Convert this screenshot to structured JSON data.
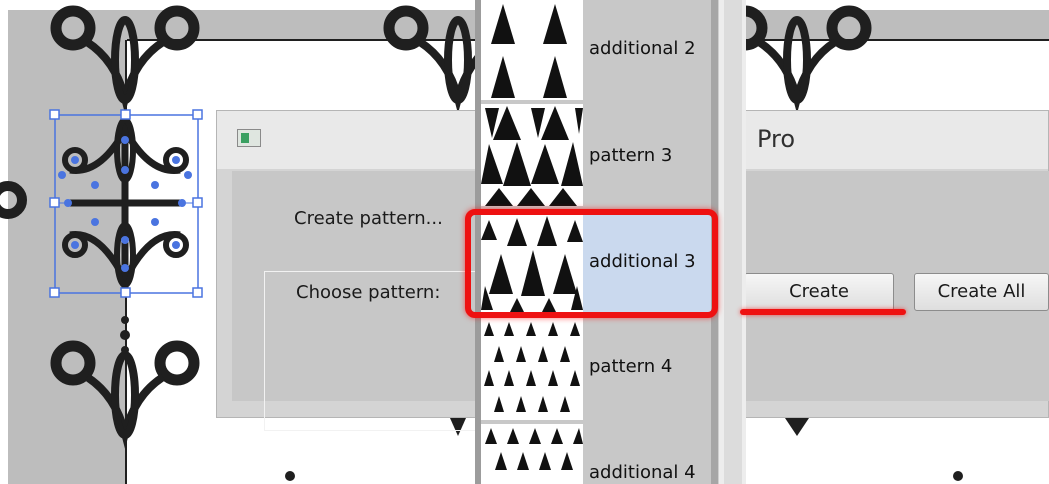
{
  "dialog": {
    "title": "Pro",
    "group_legend": "Create pattern...",
    "choose_label": "Choose pattern:",
    "create_label": "Create",
    "create_all_label": "Create All"
  },
  "pattern_list": {
    "items": [
      {
        "label": "additional 2",
        "selected": false
      },
      {
        "label": "pattern 3",
        "selected": false
      },
      {
        "label": "additional 3",
        "selected": true
      },
      {
        "label": "pattern 4",
        "selected": false
      },
      {
        "label": "additional 4",
        "selected": false
      }
    ]
  },
  "colors": {
    "annotation_red": "#ee1111",
    "selection_blue": "#4a74e0",
    "ornament_black": "#1f1f1f",
    "canvas_gray": "#bdbdbd"
  }
}
